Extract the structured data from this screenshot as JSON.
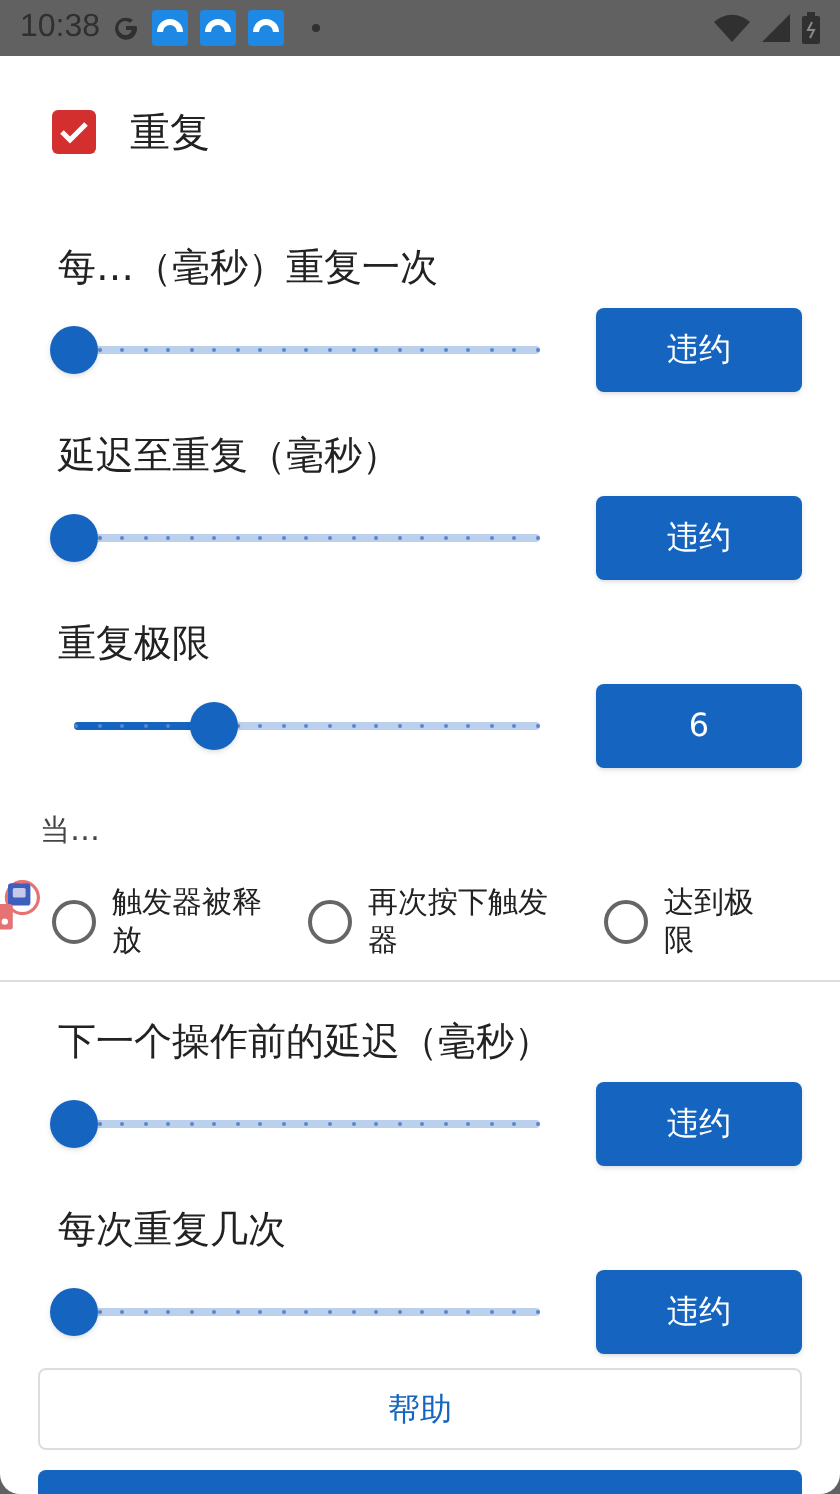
{
  "status_bar": {
    "time": "10:38"
  },
  "repeat": {
    "label": "重复",
    "checked": true
  },
  "settings": [
    {
      "label": "每…（毫秒）重复一次",
      "level": 0,
      "button": "违约"
    },
    {
      "label": "延迟至重复（毫秒）",
      "level": 0,
      "button": "违约"
    },
    {
      "label": "重复极限",
      "level": 0.3,
      "button": "6"
    }
  ],
  "stop_when": {
    "label": "当…",
    "options": [
      {
        "label": "触发器被释放",
        "selected": false
      },
      {
        "label": "再次按下触发器",
        "selected": false
      },
      {
        "label": "达到极限",
        "selected": false
      }
    ]
  },
  "more_settings": [
    {
      "label": "下一个操作前的延迟（毫秒）",
      "level": 0,
      "button": "违约"
    },
    {
      "label": "每次重复几次",
      "level": 0,
      "button": "违约"
    }
  ],
  "help_button": "帮助"
}
